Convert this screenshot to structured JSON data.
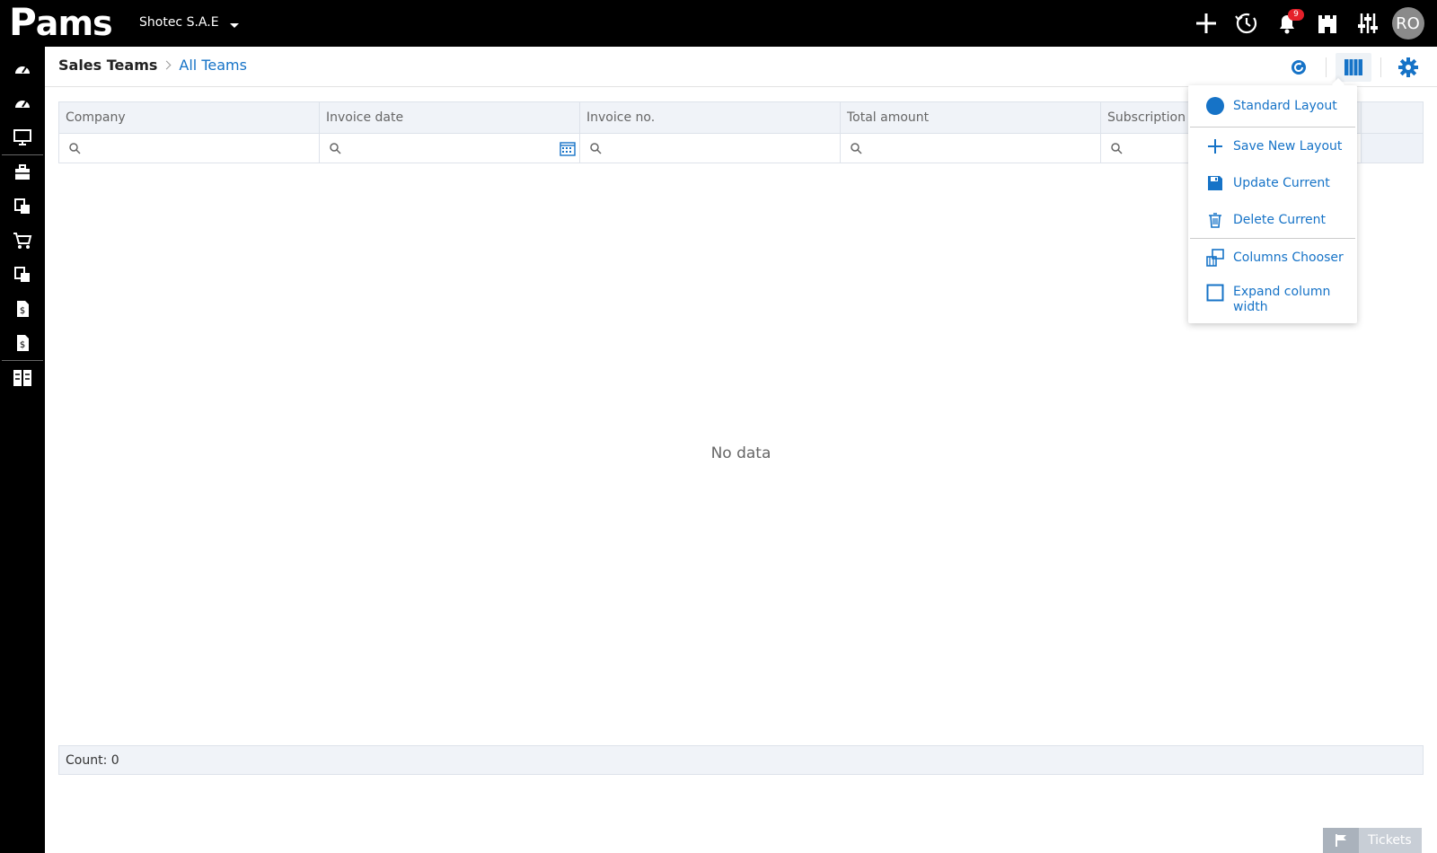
{
  "app": {
    "logo_text": "ams",
    "logo_prefix": "P"
  },
  "topbar": {
    "company": "Shotec S.A.E",
    "notifications_count": "9",
    "avatar_initials": "RO"
  },
  "breadcrumb": {
    "root": "Sales Teams",
    "current": "All Teams"
  },
  "grid": {
    "columns": [
      "Company",
      "Invoice date",
      "Invoice no.",
      "Total amount",
      "Subscription"
    ],
    "empty_text": "No data",
    "footer": "Count: 0"
  },
  "layout_menu": {
    "items": [
      {
        "label": "Standard Layout"
      },
      {
        "label": "Save New Layout"
      },
      {
        "label": "Update Current"
      },
      {
        "label": "Delete Current"
      },
      {
        "label": "Columns Chooser"
      },
      {
        "label": "Expand column width"
      }
    ]
  },
  "tickets": {
    "label": "Tickets"
  },
  "colors": {
    "accent": "#1673c7",
    "badge": "#e5202a",
    "topbar": "#000000"
  }
}
